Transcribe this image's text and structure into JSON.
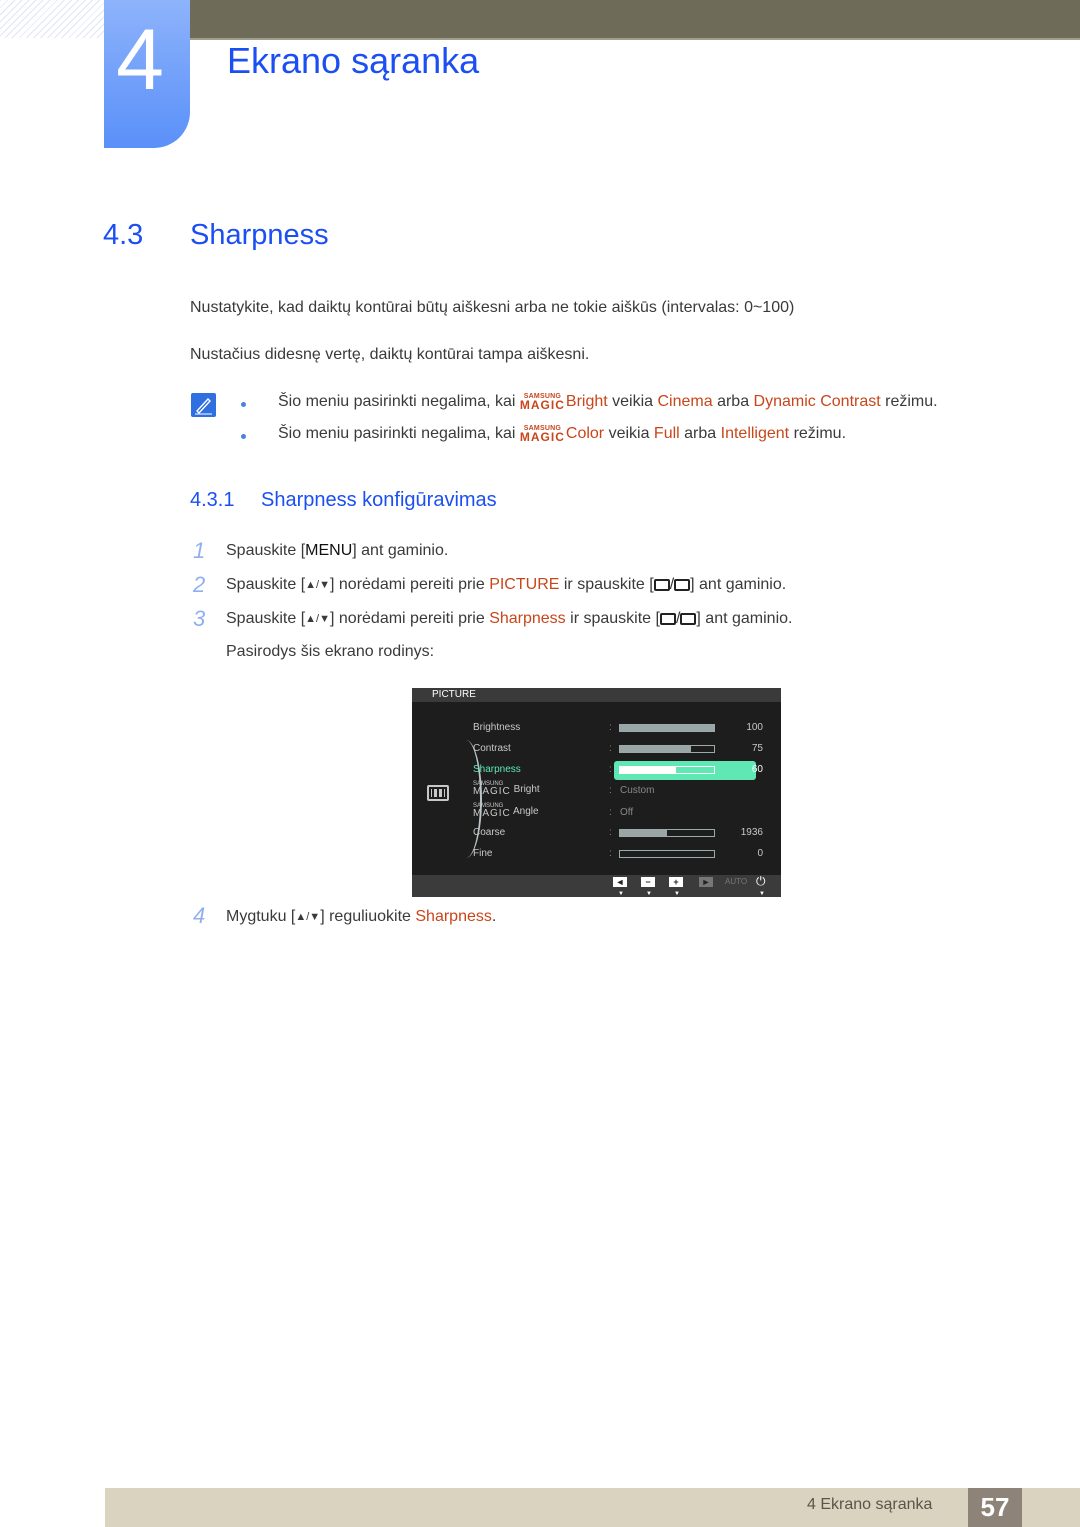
{
  "chapter": {
    "number": "4",
    "title": "Ekrano sąranka"
  },
  "section": {
    "number": "4.3",
    "title": "Sharpness"
  },
  "paragraphs": [
    "Nustatykite, kad daiktų kontūrai būtų aiškesni arba ne tokie aiškūs (intervalas: 0~100)",
    "Nustačius didesnę vertę, daiktų kontūrai tampa aiškesni."
  ],
  "notes": [
    {
      "pre": "Šio meniu pasirinkti negalima, kai ",
      "magic_top": "SAMSUNG",
      "magic_bottom": "MAGIC",
      "feature": "Bright",
      "mid1": " veikia ",
      "opt1": "Cinema",
      "mid2": " arba ",
      "opt2": "Dynamic Contrast",
      "post": " režimu."
    },
    {
      "pre": "Šio meniu pasirinkti negalima, kai ",
      "magic_top": "SAMSUNG",
      "magic_bottom": "MAGIC",
      "feature": "Color",
      "mid1": " veikia ",
      "opt1": "Full",
      "mid2": " arba ",
      "opt2": "Intelligent",
      "post": " režimu."
    }
  ],
  "subsection": {
    "number": "4.3.1",
    "title": "Sharpness konfigūravimas"
  },
  "steps": [
    {
      "n": "1",
      "a": "Spauskite [",
      "key": "MENU",
      "b": "] ant gaminio."
    },
    {
      "n": "2",
      "a": "Spauskite [",
      "arrows": "▲/▼",
      "b": "] norėdami pereiti prie ",
      "target": "PICTURE",
      "c": " ir spauskite [",
      "d": "] ant gaminio."
    },
    {
      "n": "3",
      "a": "Spauskite [",
      "arrows": "▲/▼",
      "b": "] norėdami pereiti prie ",
      "target": "Sharpness",
      "c": " ir spauskite [",
      "d": "] ant gaminio.",
      "after": "Pasirodys šis ekrano rodinys:"
    },
    {
      "n": "4",
      "a": "Mygtuku [",
      "arrows": "▲/▼",
      "b": "] reguliuokite ",
      "target": "Sharpness",
      "c": "."
    }
  ],
  "osd": {
    "title": "PICTURE",
    "items": [
      {
        "label": "Brightness",
        "type": "bar",
        "value": 100,
        "display": "100"
      },
      {
        "label": "Contrast",
        "type": "bar",
        "value": 75,
        "display": "75"
      },
      {
        "label": "Sharpness",
        "type": "bar",
        "value": 60,
        "display": "60",
        "selected": true
      },
      {
        "label": "Bright",
        "magic_top": "SAMSUNG",
        "magic_bottom": "MAGIC",
        "type": "text",
        "display": "Custom"
      },
      {
        "label": "Angle",
        "magic_top": "SAMSUNG",
        "magic_bottom": "MAGIC",
        "type": "text",
        "display": "Off"
      },
      {
        "label": "Coarse",
        "type": "bar",
        "value": 50,
        "display": "1936"
      },
      {
        "label": "Fine",
        "type": "bar",
        "value": 0,
        "display": "0"
      }
    ],
    "footer": {
      "buttons": [
        "◄",
        "−",
        "+",
        "►"
      ],
      "auto": "AUTO",
      "power": "⏻"
    }
  },
  "footer": {
    "text": "4 Ekrano sąranka",
    "page": "57"
  }
}
